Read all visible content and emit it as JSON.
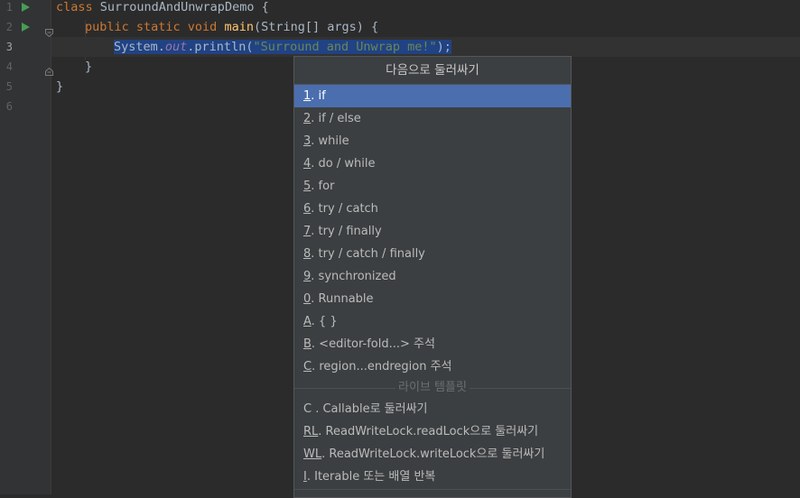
{
  "gutter": {
    "line_numbers": [
      "1",
      "2",
      "3",
      "4",
      "5",
      "6"
    ],
    "active_line": "3"
  },
  "code": {
    "line1": {
      "kw_class": "class",
      "rest": " SurroundAndUnwrapDemo {"
    },
    "line2": {
      "kw_mods": "public static void",
      "space": " ",
      "method": "main",
      "rest": "(String[] args) {"
    },
    "line3": {
      "cls": "System.",
      "field": "out",
      "call": ".println(",
      "str": "\"Surround and Unwrap me!\"",
      "end": ");"
    },
    "line4": {
      "text": "}"
    },
    "line5": {
      "text": "}"
    }
  },
  "popup": {
    "title": "다음으로 둘러싸기",
    "items": [
      {
        "mn": "1",
        "label": ". if"
      },
      {
        "mn": "2",
        "label": ". if / else"
      },
      {
        "mn": "3",
        "label": ". while"
      },
      {
        "mn": "4",
        "label": ". do / while"
      },
      {
        "mn": "5",
        "label": ". for"
      },
      {
        "mn": "6",
        "label": ". try / catch"
      },
      {
        "mn": "7",
        "label": ". try / finally"
      },
      {
        "mn": "8",
        "label": ". try / catch / finally"
      },
      {
        "mn": "9",
        "label": ". synchronized"
      },
      {
        "mn": "0",
        "label": ". Runnable"
      },
      {
        "mn": "A",
        "label": ". { }"
      },
      {
        "mn": "B",
        "label": ". <editor-fold...> 주석"
      },
      {
        "mn": "C",
        "label": ". region...endregion 주석"
      }
    ],
    "selected_index": 0,
    "live_templates_header": "라이브 템플릿",
    "templates": [
      {
        "mn": "",
        "label": "C . Callable로 둘러싸기"
      },
      {
        "mn": "RL",
        "label": ". ReadWriteLock.readLock으로 둘러싸기"
      },
      {
        "mn": "WL",
        "label": ". ReadWriteLock.writeLock으로 둘러싸기"
      },
      {
        "mn": "I",
        "label": ". Iterable 또는 배열 반복"
      }
    ]
  },
  "colors": {
    "background": "#2b2b2b",
    "selection": "#214283",
    "popup_selected": "#4b6eaf",
    "keyword": "#cc7832",
    "string": "#6a8759",
    "run_icon": "#499c54"
  },
  "icons": [
    "run-icon",
    "fold-icon"
  ]
}
